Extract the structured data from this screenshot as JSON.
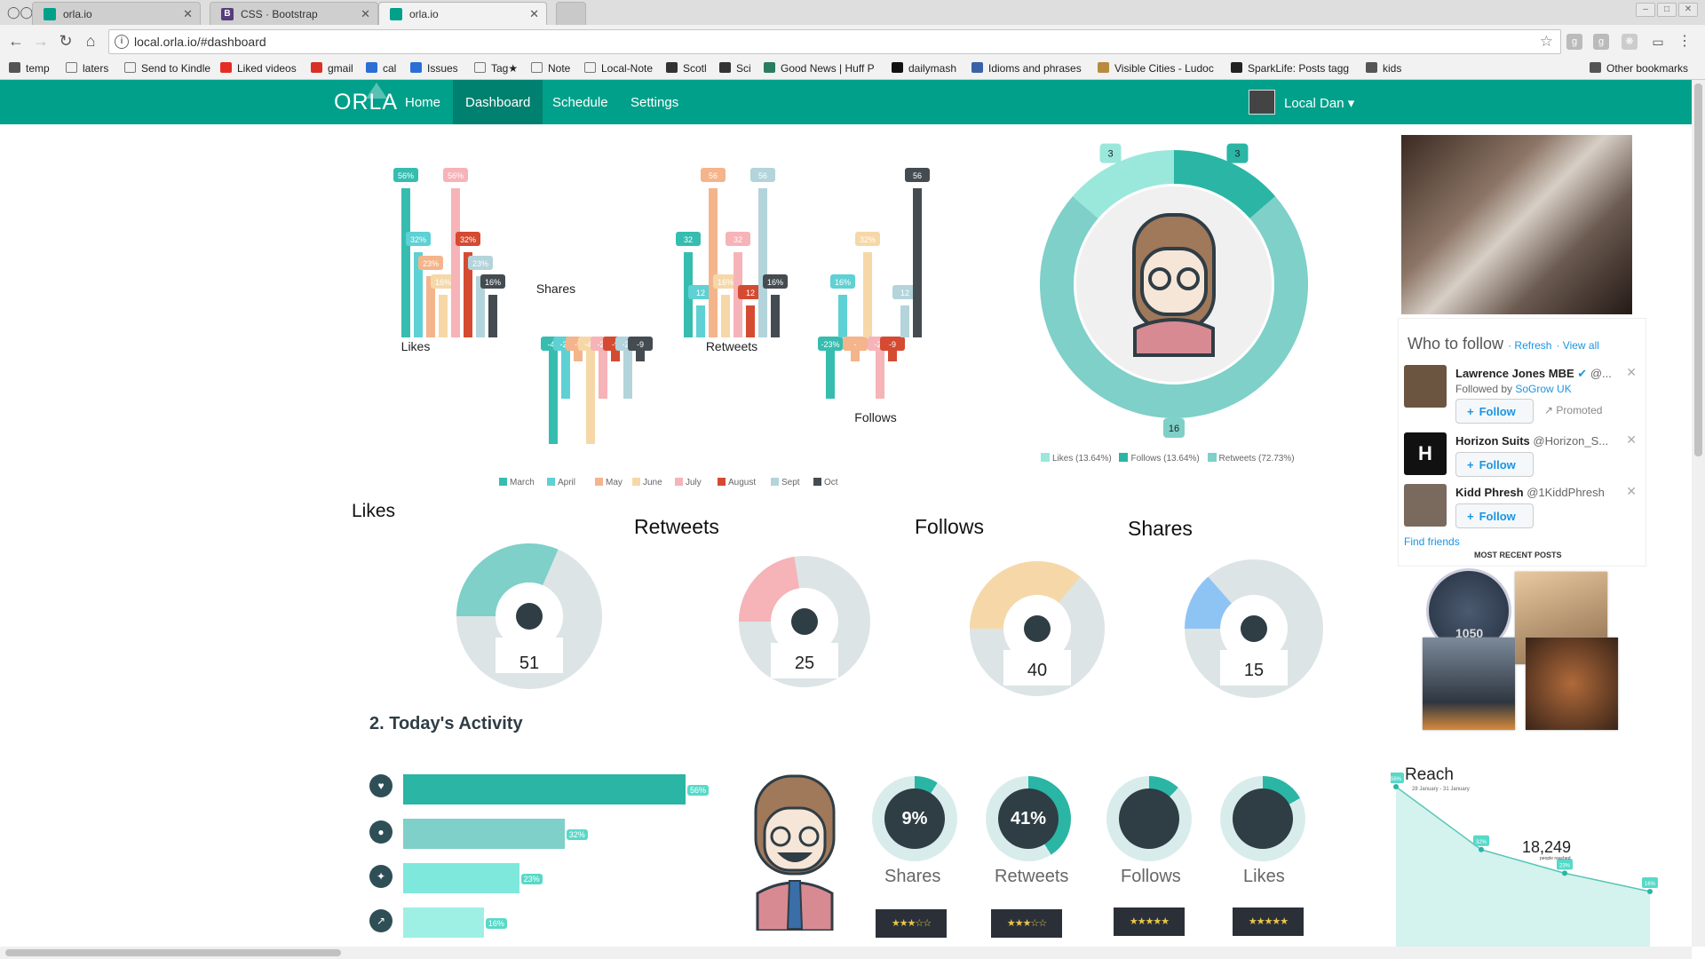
{
  "browser": {
    "tabs": [
      {
        "title": "orla.io",
        "color": "#00a08a"
      },
      {
        "title": "CSS · Bootstrap",
        "color": "#563d7c",
        "icon_letter": "B"
      },
      {
        "title": "orla.io",
        "color": "#00a08a"
      }
    ],
    "url": "local.orla.io/#dashboard",
    "bookmarks": [
      "temp",
      "laters",
      "Send to Kindle",
      "Liked videos",
      "gmail",
      "cal",
      "Issues",
      "Tag★",
      "Note",
      "Local-Note",
      "Scotl",
      "Sci",
      "Good News | Huff P",
      "dailymash",
      "Idioms and phrases",
      "Visible Cities - Ludoc",
      "SparkLife: Posts tagg",
      "kids",
      "Other bookmarks"
    ]
  },
  "nav": {
    "logo": "ORLA",
    "links": [
      "Home",
      "Dashboard",
      "Schedule",
      "Settings"
    ],
    "active": "Dashboard",
    "user": "Local Dan ▾"
  },
  "chart_data": [
    {
      "type": "bar",
      "categories": [
        "March",
        "April",
        "May",
        "June",
        "July",
        "August",
        "Sept",
        "Oct"
      ],
      "colors": [
        "#36bdb0",
        "#5ed1d4",
        "#f4b48c",
        "#f6d8a8",
        "#f6b3b8",
        "#d44b32",
        "#b3d4db",
        "#444c52"
      ],
      "groups": [
        {
          "name": "Likes",
          "values": [
            56,
            32,
            23,
            16,
            56,
            32,
            23,
            16
          ],
          "labels": [
            "56%",
            "32%",
            "23%",
            "16%",
            "56%",
            "32%",
            "23%",
            "16%"
          ]
        },
        {
          "name": "Shares",
          "values": [
            -40,
            -23,
            -9,
            -40,
            -23,
            -9,
            -23,
            -9
          ],
          "labels": [
            "-40",
            "-23",
            "-9",
            "-40",
            "-23",
            "-9",
            "-23",
            "-9"
          ]
        },
        {
          "name": "Retweets",
          "values": [
            32,
            12,
            56,
            16,
            32,
            12,
            56,
            16
          ],
          "labels": [
            "32",
            "12",
            "56",
            "16%",
            "32",
            "12",
            "56",
            "16%"
          ]
        },
        {
          "name": "Follows",
          "values": [
            -23,
            16,
            -9,
            32,
            -23,
            -9,
            12,
            56
          ],
          "labels": [
            "-23%",
            "16%",
            "-",
            "32%",
            "-23",
            "-9",
            "12",
            "56"
          ]
        }
      ]
    },
    {
      "type": "pie",
      "categories": [
        "Likes",
        "Follows",
        "Retweets"
      ],
      "values": [
        13.64,
        13.64,
        72.73
      ],
      "legend": [
        "Likes (13.64%)",
        "Follows (13.64%)",
        "Retweets (72.73%)"
      ],
      "counts": [
        "3",
        "3",
        "16"
      ],
      "colors": [
        "#9ae8db",
        "#2ab5a5",
        "#7ed0c8"
      ]
    },
    {
      "type": "line",
      "title": "Reach",
      "subtitle": "28 January - 31 January",
      "values": [
        56,
        32,
        23,
        16
      ],
      "labels": [
        "56%",
        "32%",
        "23%",
        "16%"
      ],
      "annotation": "18,249",
      "annotation_sub": "people reached"
    }
  ],
  "gauges": {
    "titles": [
      "Likes",
      "Retweets",
      "Follows",
      "Shares"
    ],
    "values": [
      "51",
      "25",
      "40",
      "15"
    ],
    "colors": [
      "#7ed0c8",
      "#f6b3b8",
      "#f6d8a8",
      "#8ec4f4"
    ],
    "fractions": [
      0.35,
      0.25,
      0.4,
      0.15
    ]
  },
  "activity": {
    "title": "2. Today's Activity",
    "bars": [
      {
        "pct": 56,
        "label": "56%",
        "color": "#2ab5a5"
      },
      {
        "pct": 32,
        "label": "32%",
        "color": "#7ed0c8"
      },
      {
        "pct": 23,
        "label": "23%",
        "color": "#7ee8dc"
      },
      {
        "pct": 16,
        "label": "16%",
        "color": "#9ef0e4"
      }
    ],
    "bubbles": [
      {
        "value": "9%",
        "label": "Shares",
        "fraction": 0.09
      },
      {
        "value": "41%",
        "label": "Retweets",
        "fraction": 0.41
      },
      {
        "value": "",
        "label": "Follows",
        "fraction": 0.12
      },
      {
        "value": "",
        "label": "Likes",
        "fraction": 0.17
      }
    ],
    "ratings": [
      "★★★☆☆",
      "★★★☆☆",
      "★★★★★",
      "★★★★★"
    ]
  },
  "who_to_follow": {
    "title": "Who to follow",
    "refresh": "Refresh",
    "view_all": "View all",
    "follow_label": "Follow",
    "promoted": "Promoted",
    "find_friends": "Find friends",
    "people": [
      {
        "name": "Lawrence Jones MBE",
        "handle": "@...",
        "followed_by": "Followed by",
        "followed_by_name": "SoGrow UK"
      },
      {
        "name": "Horizon Suits",
        "handle": "@Horizon_S..."
      },
      {
        "name": "Kidd Phresh",
        "handle": "@1KiddPhresh"
      }
    ],
    "recent_posts_title": "MOST RECENT POSTS",
    "recent_count": "1050"
  }
}
